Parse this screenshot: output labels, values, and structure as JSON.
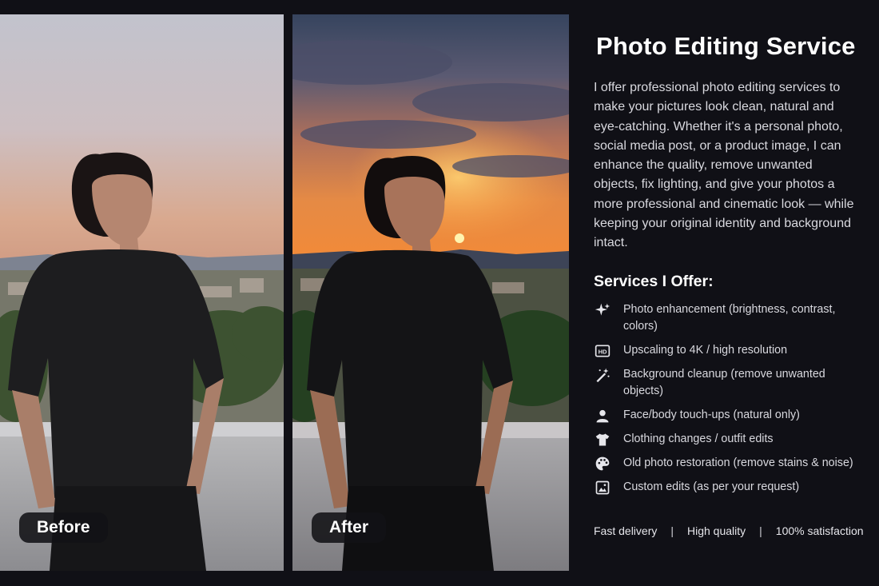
{
  "before_label": "Before",
  "after_label": "After",
  "title": "Photo Editing Service",
  "description": "I offer professional photo editing services to make your pictures look clean, natural and eye-catching. Whether it's a personal photo, social media post, or a product image, I can enhance the quality, remove unwanted objects, fix lighting, and give your photos a more professional and cinematic look — while keeping your original identity and background intact.",
  "services_heading": "Services I Offer:",
  "services": [
    {
      "icon": "sparkle-icon",
      "text": "Photo enhancement (brightness, contrast, colors)"
    },
    {
      "icon": "hd-icon",
      "text": "Upscaling to 4K / high resolution"
    },
    {
      "icon": "magic-wand-icon",
      "text": "Background cleanup (remove unwanted objects)"
    },
    {
      "icon": "person-icon",
      "text": "Face/body touch-ups (natural only)"
    },
    {
      "icon": "tshirt-icon",
      "text": "Clothing changes / outfit edits"
    },
    {
      "icon": "palette-icon",
      "text": "Old photo restoration (remove stains & noise)"
    },
    {
      "icon": "image-icon",
      "text": "Custom edits (as per your request)"
    }
  ],
  "footer": {
    "item1": "Fast delivery",
    "item2": "High quality",
    "item3": "100% satisfaction",
    "separator": "|"
  },
  "colors": {
    "background": "#101016",
    "before_sky": "#c9c4cf",
    "after_sky": "#e9803a"
  }
}
